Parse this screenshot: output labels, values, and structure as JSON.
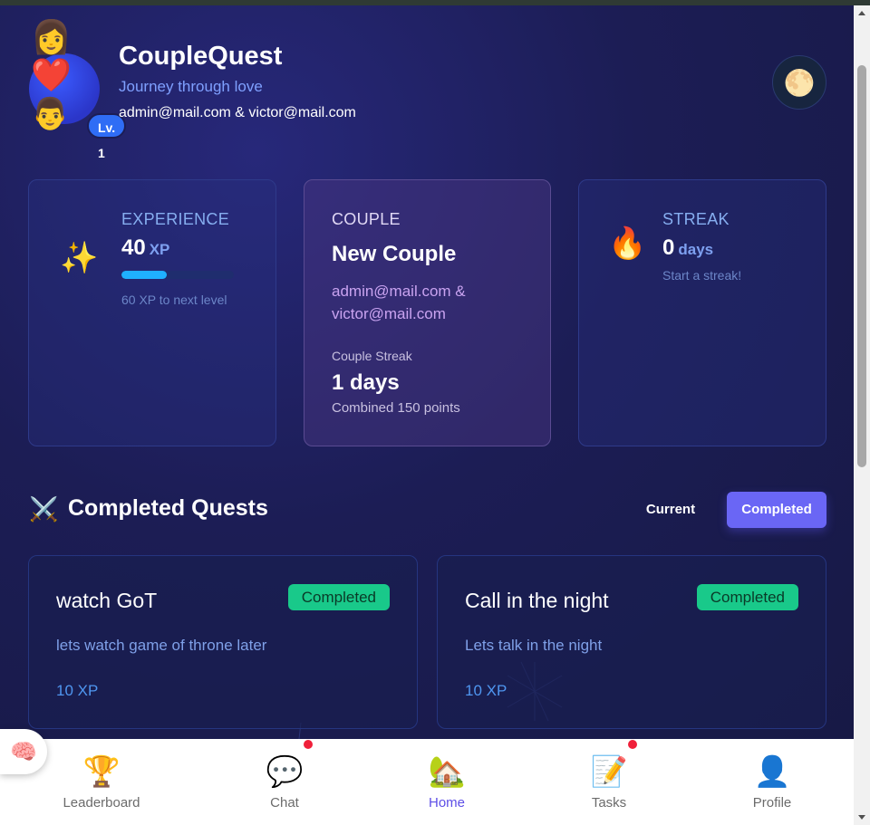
{
  "header": {
    "title": "CoupleQuest",
    "subtitle": "Journey through love",
    "emails": "admin@mail.com & victor@mail.com",
    "level_badge": "Lv. 1",
    "avatar_icons": [
      "woman-icon",
      "heart-icon",
      "man-icon"
    ],
    "theme_toggle_icon": "moon-icon"
  },
  "stats": {
    "experience": {
      "label": "EXPERIENCE",
      "value": "40",
      "unit": "XP",
      "progress_fraction": 0.4,
      "note": "60 XP to next level",
      "icon": "sparkles-icon"
    },
    "couple": {
      "label": "COUPLE",
      "name": "New Couple",
      "emails": "admin@mail.com & victor@mail.com",
      "streak_label": "Couple Streak",
      "streak_value": "1 days",
      "points": "Combined 150 points"
    },
    "streak": {
      "label": "STREAK",
      "value": "0",
      "unit": "days",
      "note": "Start a streak!",
      "icon": "fire-icon"
    }
  },
  "quests_section": {
    "title": "Completed Quests",
    "icon": "crossed-swords-icon",
    "tabs": [
      {
        "label": "Current",
        "active": false
      },
      {
        "label": "Completed",
        "active": true
      }
    ]
  },
  "quests": [
    {
      "title": "watch GoT",
      "status": "Completed",
      "description": "lets watch game of throne later",
      "xp": "10 XP"
    },
    {
      "title": "Call in the night",
      "status": "Completed",
      "description": "Lets talk in the night",
      "xp": "10 XP"
    }
  ],
  "bottom_nav": [
    {
      "label": "Leaderboard",
      "icon": "trophy-icon",
      "active": false,
      "notification": false
    },
    {
      "label": "Chat",
      "icon": "chat-bubble-icon",
      "active": false,
      "notification": true
    },
    {
      "label": "Home",
      "icon": "house-icon",
      "active": true,
      "notification": false
    },
    {
      "label": "Tasks",
      "icon": "memo-icon",
      "active": false,
      "notification": true
    },
    {
      "label": "Profile",
      "icon": "person-icon",
      "active": false,
      "notification": false
    }
  ],
  "assistant_button_icon": "brain-icon",
  "colors": {
    "accent": "#6a66f5",
    "background": "#1c1d55",
    "success": "#19c98a",
    "progress": "#1fb0ff",
    "notification": "#f0203a",
    "nav_active": "#5d4ee6"
  }
}
